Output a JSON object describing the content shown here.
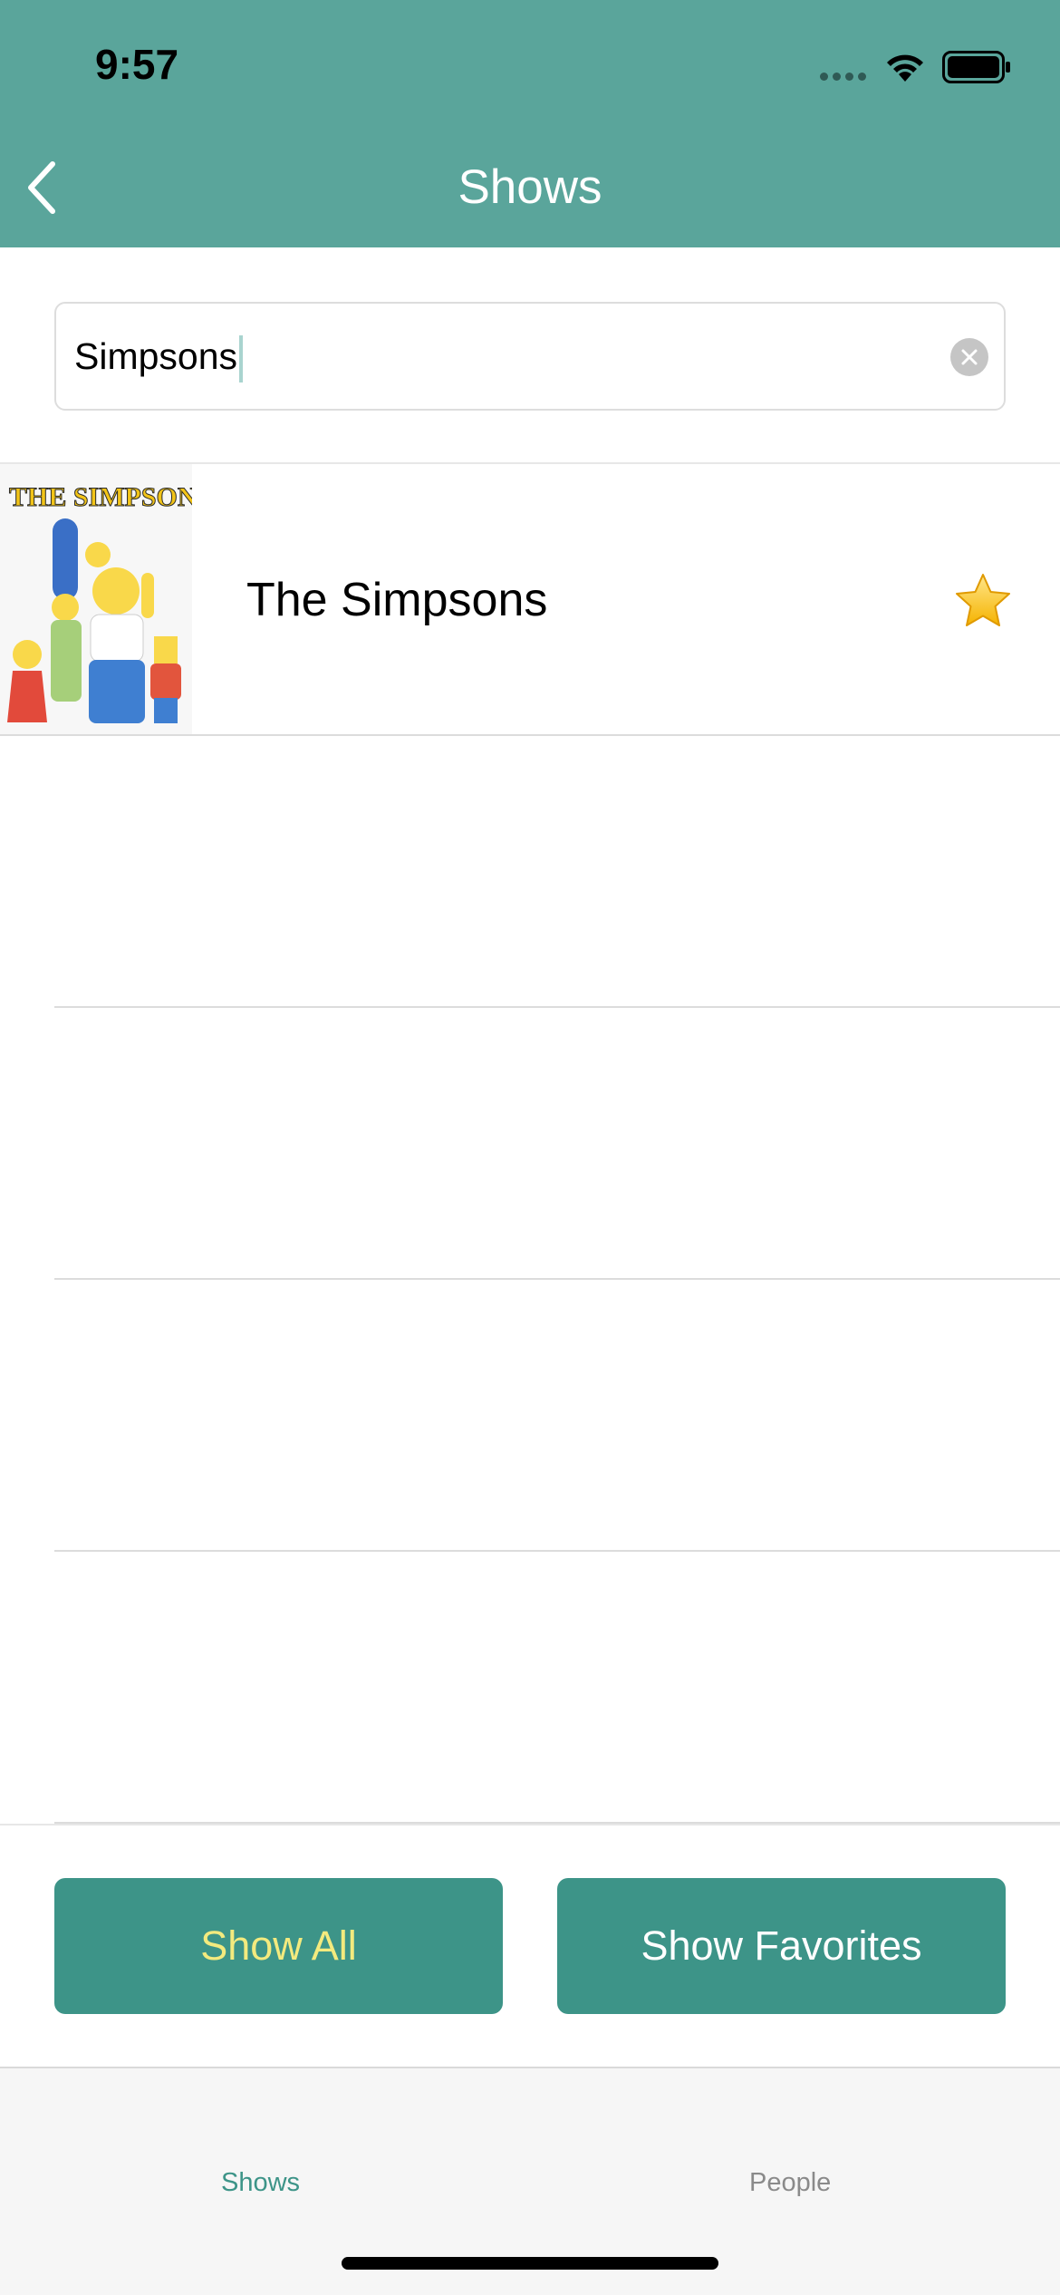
{
  "status_bar": {
    "time": "9:57"
  },
  "nav": {
    "title": "Shows",
    "back_icon": "chevron-left-icon"
  },
  "search": {
    "value": "Simpsons",
    "clear_icon": "clear-circle-icon"
  },
  "results": [
    {
      "title": "The Simpsons",
      "poster_caption": "THE SIMPSONS",
      "favorite": true
    }
  ],
  "buttons": {
    "show_all": "Show All",
    "show_favorites": "Show Favorites"
  },
  "tabs": [
    {
      "label": "Shows",
      "active": true
    },
    {
      "label": "People",
      "active": false
    }
  ],
  "colors": {
    "header": "#5aa59b",
    "button": "#3d9488",
    "show_all_text": "#f3ea7e",
    "active_tab": "#3d9488",
    "inactive_tab": "#8a8a8a"
  }
}
